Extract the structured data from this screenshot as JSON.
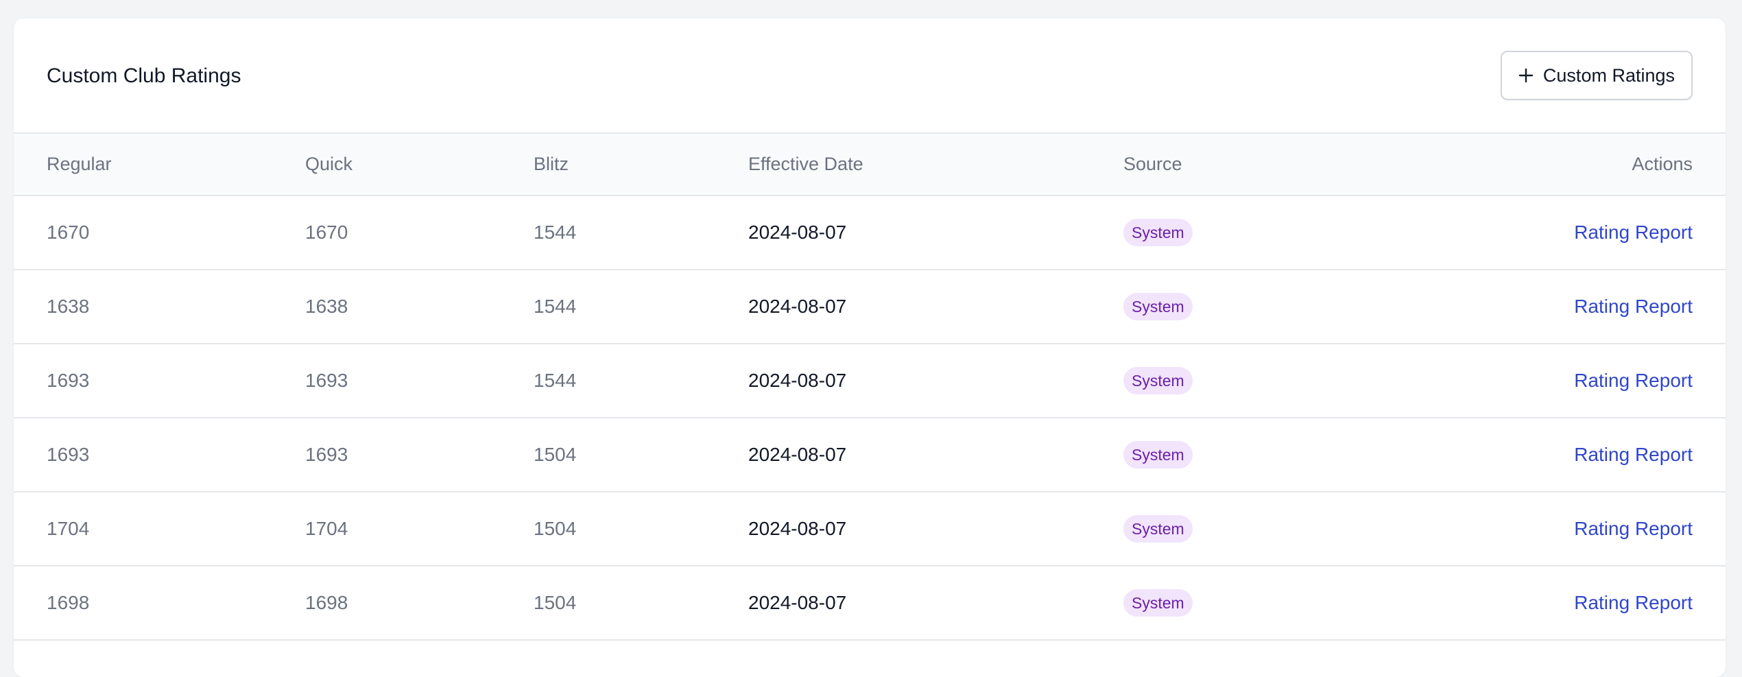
{
  "card": {
    "title": "Custom Club Ratings",
    "add_button_label": "Custom Ratings",
    "add_button_icon": "plus-icon"
  },
  "table": {
    "columns": {
      "regular": "Regular",
      "quick": "Quick",
      "blitz": "Blitz",
      "effective_date": "Effective Date",
      "source": "Source",
      "actions": "Actions"
    },
    "rows": [
      {
        "regular": "1670",
        "quick": "1670",
        "blitz": "1544",
        "effective_date": "2024-08-07",
        "source": "System",
        "action": "Rating Report"
      },
      {
        "regular": "1638",
        "quick": "1638",
        "blitz": "1544",
        "effective_date": "2024-08-07",
        "source": "System",
        "action": "Rating Report"
      },
      {
        "regular": "1693",
        "quick": "1693",
        "blitz": "1544",
        "effective_date": "2024-08-07",
        "source": "System",
        "action": "Rating Report"
      },
      {
        "regular": "1693",
        "quick": "1693",
        "blitz": "1504",
        "effective_date": "2024-08-07",
        "source": "System",
        "action": "Rating Report"
      },
      {
        "regular": "1704",
        "quick": "1704",
        "blitz": "1504",
        "effective_date": "2024-08-07",
        "source": "System",
        "action": "Rating Report"
      },
      {
        "regular": "1698",
        "quick": "1698",
        "blitz": "1504",
        "effective_date": "2024-08-07",
        "source": "System",
        "action": "Rating Report"
      }
    ]
  },
  "colors": {
    "badge_background": "#f1e4fb",
    "badge_text": "#6b21a8",
    "link": "#3046c9",
    "page_background": "#f3f4f6"
  }
}
